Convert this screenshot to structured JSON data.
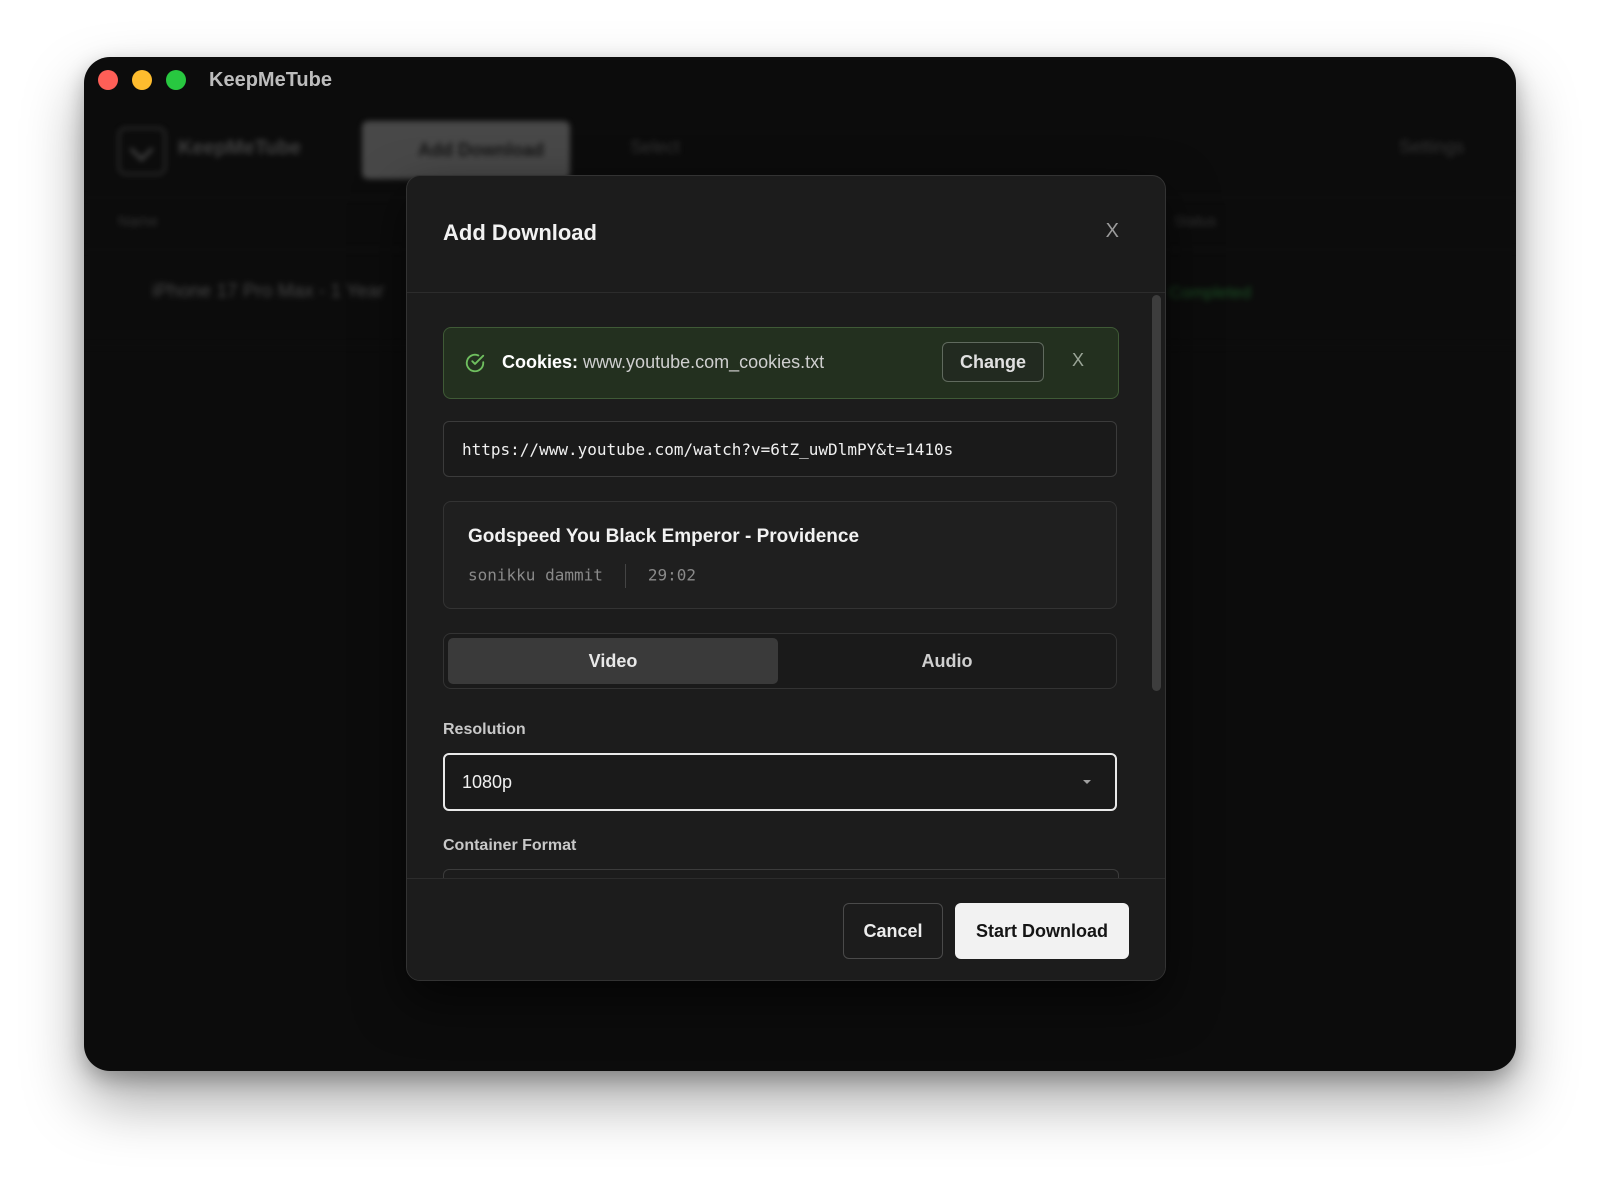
{
  "window": {
    "title": "KeepMeTube"
  },
  "background_app": {
    "app_name": "KeepMeTube",
    "add_download_label": "Add Download",
    "select_label": "Select",
    "settings_label": "Settings",
    "column_name": "Name",
    "column_status": "Status",
    "row_title": "iPhone 17 Pro Max - 1 Year",
    "row_status": "Completed"
  },
  "modal": {
    "title": "Add Download",
    "close": "X",
    "cookies": {
      "label": "Cookies:",
      "file": "www.youtube.com_cookies.txt",
      "change_label": "Change",
      "remove": "X",
      "color": "#3f5a36"
    },
    "url": "https://www.youtube.com/watch?v=6tZ_uwDlmPY&t=1410s",
    "video": {
      "title": "Godspeed You Black Emperor - Providence",
      "channel": "sonikku dammit",
      "duration": "29:02"
    },
    "tabs": {
      "video": "Video",
      "audio": "Audio",
      "selected": "Video"
    },
    "resolution": {
      "label": "Resolution",
      "value": "1080p"
    },
    "container": {
      "label": "Container Format"
    },
    "footer": {
      "cancel": "Cancel",
      "start": "Start Download"
    }
  }
}
